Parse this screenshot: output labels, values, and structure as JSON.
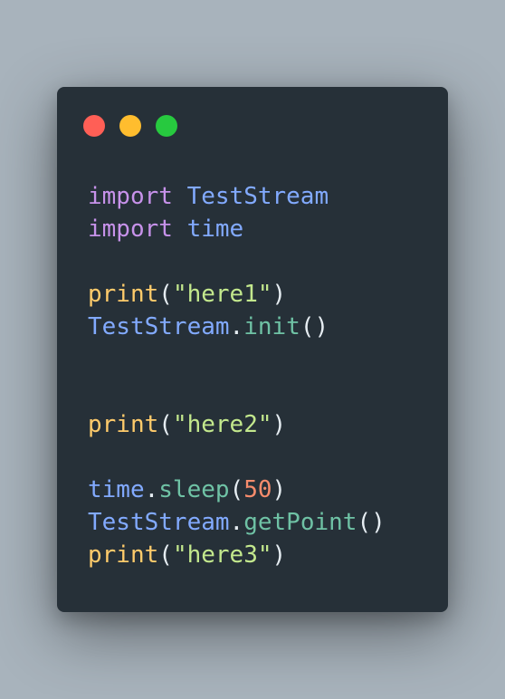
{
  "window_controls": {
    "colors": [
      "#ff5f56",
      "#ffbd2e",
      "#27c93f"
    ]
  },
  "code": {
    "lines": [
      {
        "tokens": [
          {
            "t": "import",
            "c": "kw"
          },
          {
            "t": " ",
            "c": "punc"
          },
          {
            "t": "TestStream",
            "c": "mod"
          }
        ]
      },
      {
        "tokens": [
          {
            "t": "import",
            "c": "kw"
          },
          {
            "t": " ",
            "c": "punc"
          },
          {
            "t": "time",
            "c": "mod"
          }
        ]
      },
      {
        "tokens": []
      },
      {
        "tokens": [
          {
            "t": "print",
            "c": "fn"
          },
          {
            "t": "(",
            "c": "punc"
          },
          {
            "t": "\"here1\"",
            "c": "str"
          },
          {
            "t": ")",
            "c": "punc"
          }
        ]
      },
      {
        "tokens": [
          {
            "t": "TestStream",
            "c": "mod"
          },
          {
            "t": ".",
            "c": "punc"
          },
          {
            "t": "init",
            "c": "call"
          },
          {
            "t": "()",
            "c": "punc"
          }
        ]
      },
      {
        "tokens": []
      },
      {
        "tokens": []
      },
      {
        "tokens": [
          {
            "t": "print",
            "c": "fn"
          },
          {
            "t": "(",
            "c": "punc"
          },
          {
            "t": "\"here2\"",
            "c": "str"
          },
          {
            "t": ")",
            "c": "punc"
          }
        ]
      },
      {
        "tokens": []
      },
      {
        "tokens": [
          {
            "t": "time",
            "c": "mod"
          },
          {
            "t": ".",
            "c": "punc"
          },
          {
            "t": "sleep",
            "c": "call"
          },
          {
            "t": "(",
            "c": "punc"
          },
          {
            "t": "50",
            "c": "num"
          },
          {
            "t": ")",
            "c": "punc"
          }
        ]
      },
      {
        "tokens": [
          {
            "t": "TestStream",
            "c": "mod"
          },
          {
            "t": ".",
            "c": "punc"
          },
          {
            "t": "getPoint",
            "c": "call"
          },
          {
            "t": "()",
            "c": "punc"
          }
        ]
      },
      {
        "tokens": [
          {
            "t": "print",
            "c": "fn"
          },
          {
            "t": "(",
            "c": "punc"
          },
          {
            "t": "\"here3\"",
            "c": "str"
          },
          {
            "t": ")",
            "c": "punc"
          }
        ]
      }
    ]
  }
}
